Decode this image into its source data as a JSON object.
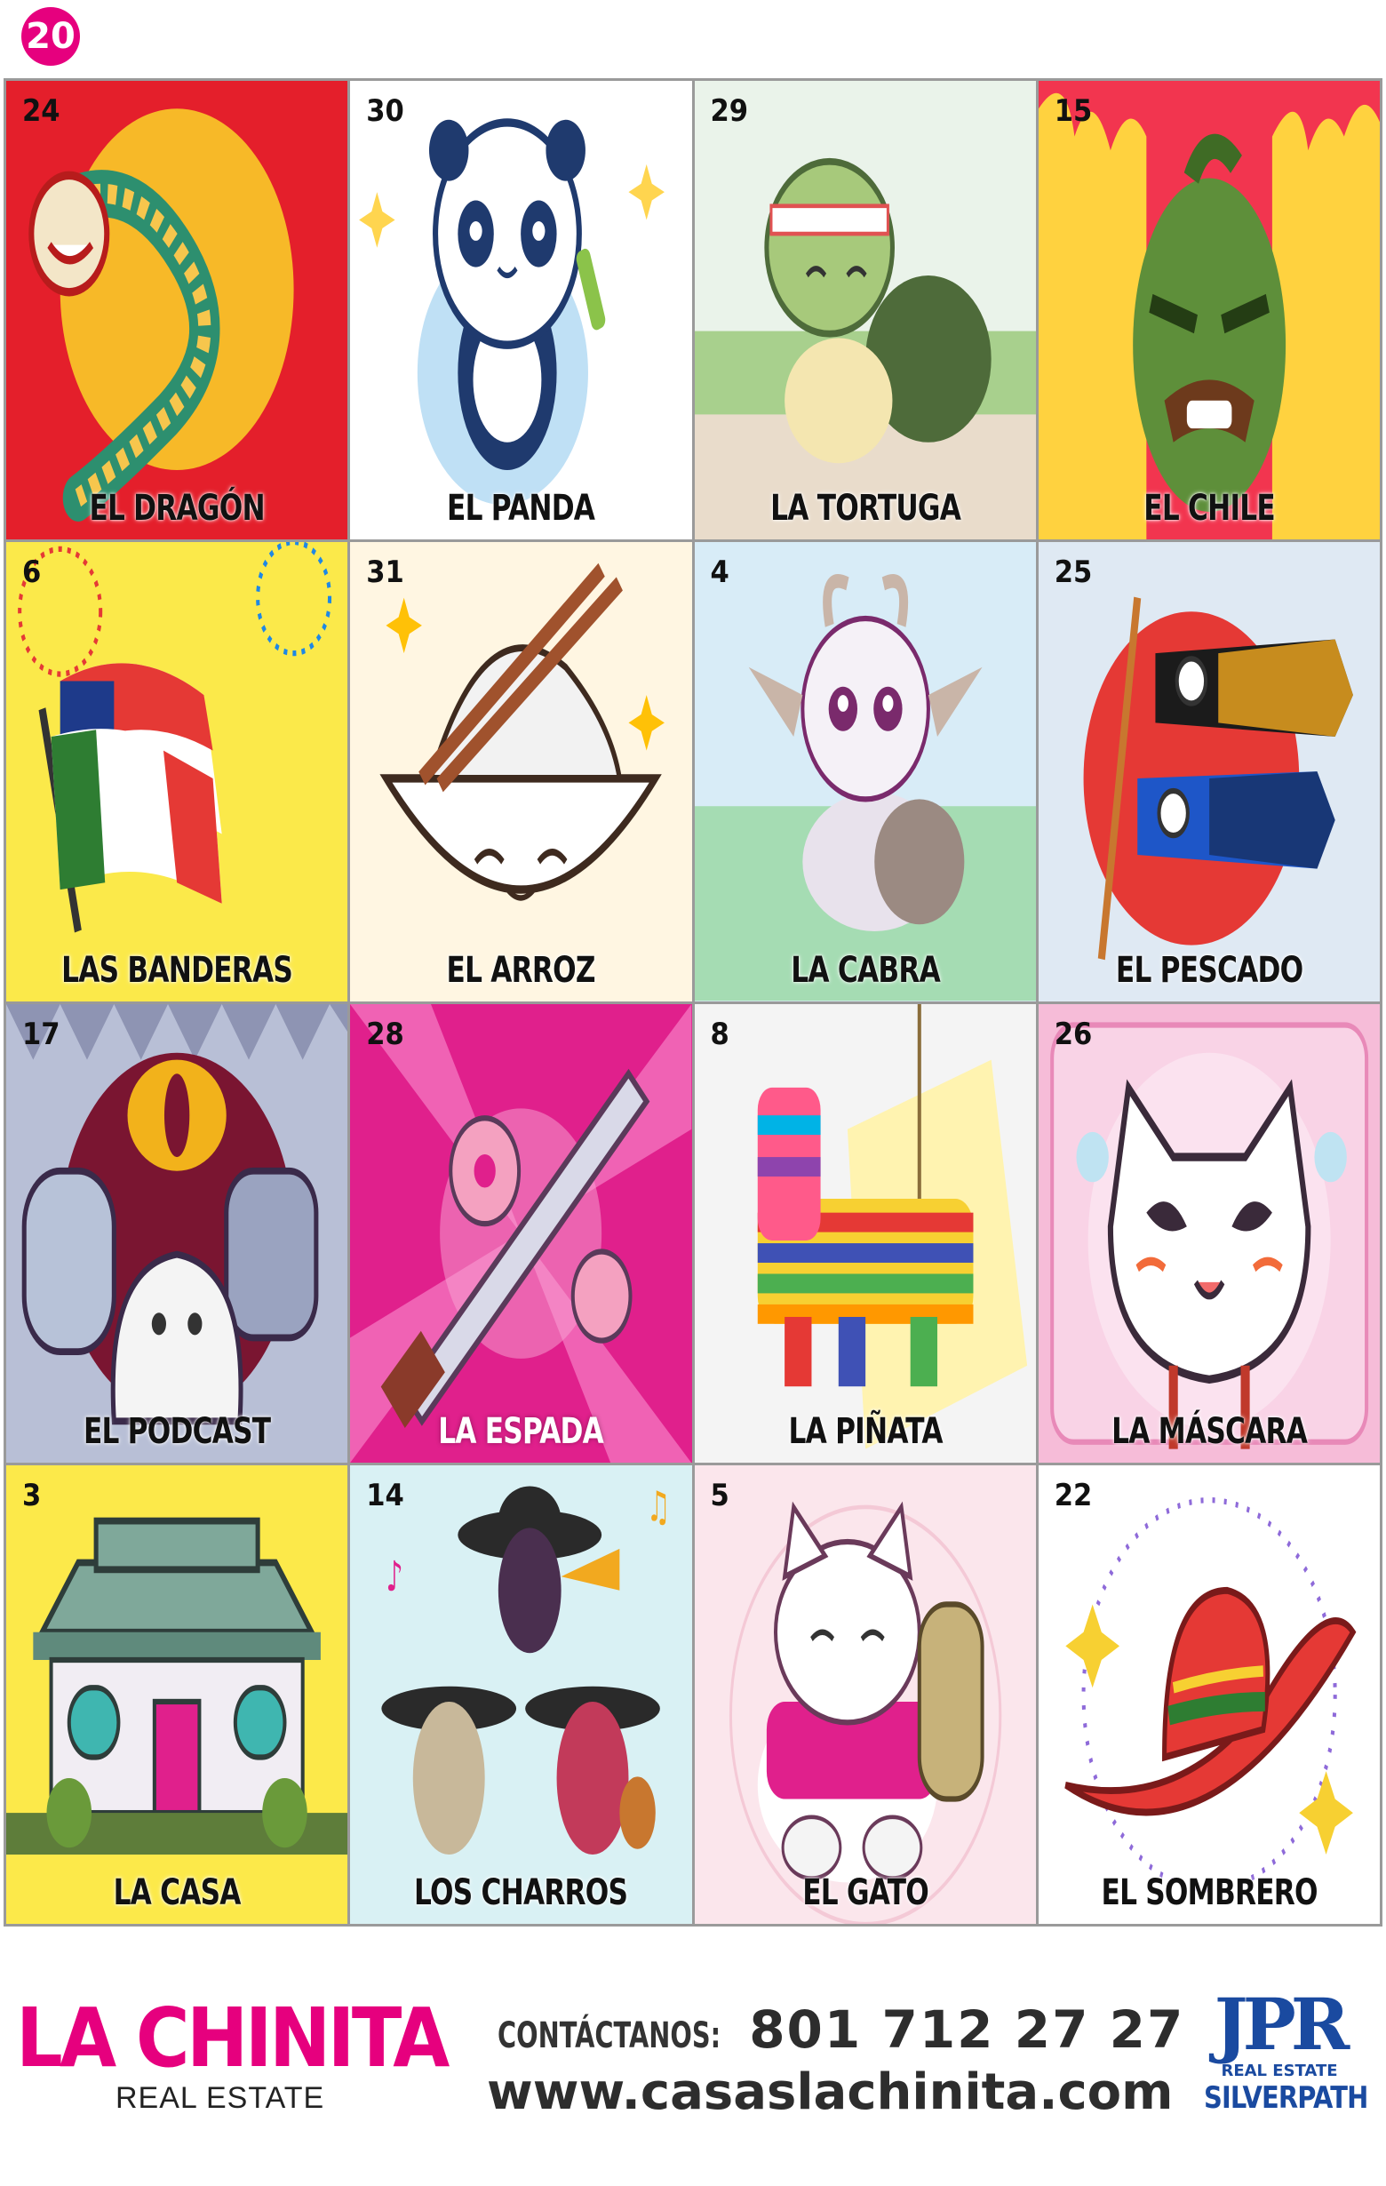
{
  "board": {
    "number": "20"
  },
  "cards": [
    {
      "number": "24",
      "name": "EL DRAGÓN",
      "bg": "#e41f2b"
    },
    {
      "number": "30",
      "name": "EL PANDA",
      "bg": "#ffffff"
    },
    {
      "number": "29",
      "name": "LA TORTUGA",
      "bg": "#f6f3e8"
    },
    {
      "number": "15",
      "name": "EL CHILE",
      "bg": "#f2354f"
    },
    {
      "number": "6",
      "name": "LAS BANDERAS",
      "bg": "#fbe94a"
    },
    {
      "number": "31",
      "name": "EL ARROZ",
      "bg": "#fff6e2"
    },
    {
      "number": "4",
      "name": "LA CABRA",
      "bg": "#d8ecf7"
    },
    {
      "number": "25",
      "name": "EL PESCADO",
      "bg": "#dfe9f3"
    },
    {
      "number": "17",
      "name": "EL PODCAST",
      "bg": "#b8bfd6"
    },
    {
      "number": "28",
      "name": "LA ESPADA",
      "bg": "#e0208c"
    },
    {
      "number": "8",
      "name": "LA PIÑATA",
      "bg": "#f4f4f4"
    },
    {
      "number": "26",
      "name": "LA MÁSCARA",
      "bg": "#f6bcd8"
    },
    {
      "number": "3",
      "name": "LA CASA",
      "bg": "#fce94a"
    },
    {
      "number": "14",
      "name": "LOS CHARROS",
      "bg": "#d9f1f4"
    },
    {
      "number": "5",
      "name": "EL GATO",
      "bg": "#fbe6ec"
    },
    {
      "number": "22",
      "name": "EL SOMBRERO",
      "bg": "#ffffff"
    }
  ],
  "footer": {
    "brand": "LA CHINITA",
    "brand_sub": "REAL ESTATE",
    "contact_label": "CONTÁCTANOS:",
    "phone": "801 712 27 27",
    "website": "www.casaslachinita.com",
    "partner_logo": "JPR",
    "partner_sub": "REAL ESTATE",
    "partner_name": "SILVERPATH"
  }
}
